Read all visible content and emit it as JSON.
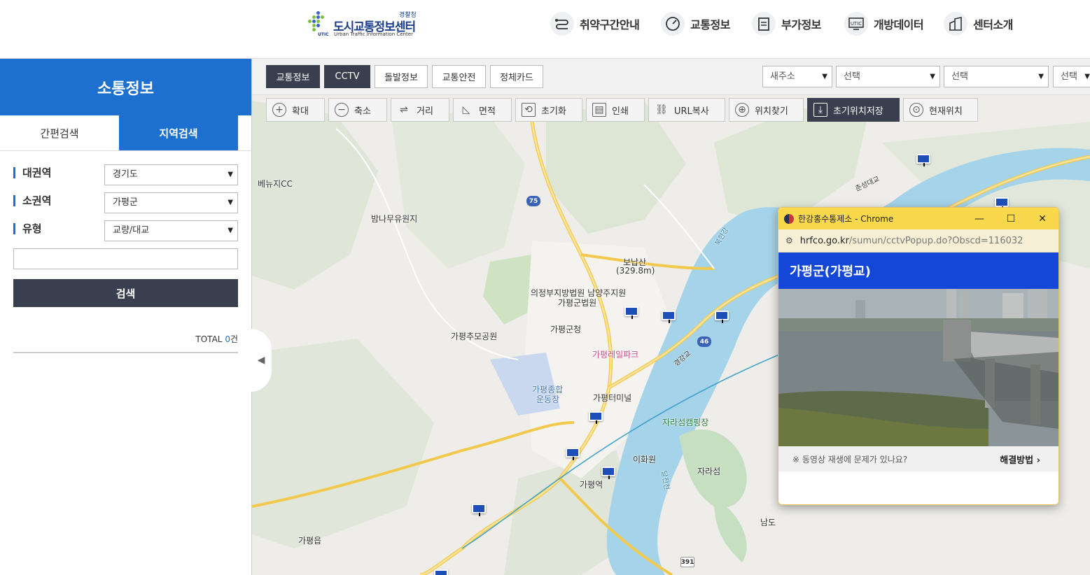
{
  "header": {
    "logo_title": "도시교통정보센터",
    "logo_police": "경찰청",
    "logo_en": "Urban Traffic Information Center",
    "logo_utic": "UTIC",
    "nav": [
      {
        "label": "취약구간안내",
        "icon": "route-icon"
      },
      {
        "label": "교통정보",
        "icon": "gauge-icon"
      },
      {
        "label": "부가정보",
        "icon": "clipboard-icon"
      },
      {
        "label": "개방데이터",
        "icon": "utic-monitor-icon"
      },
      {
        "label": "센터소개",
        "icon": "building-icon"
      }
    ]
  },
  "sidebar": {
    "title": "소통정보",
    "tabs": [
      "간편검색",
      "지역검색"
    ],
    "fields": [
      {
        "label": "대권역",
        "value": "경기도"
      },
      {
        "label": "소권역",
        "value": "가평군"
      },
      {
        "label": "유형",
        "value": "교량/대교"
      }
    ],
    "search_value": "",
    "search_button": "검색",
    "total_prefix": "TOTAL",
    "total_count": "0",
    "total_suffix": "건"
  },
  "map_topbar": {
    "tabs": [
      {
        "label": "교통정보",
        "active": true
      },
      {
        "label": "CCTV",
        "active": true
      },
      {
        "label": "돌발정보",
        "active": false
      },
      {
        "label": "교통안전",
        "active": false
      },
      {
        "label": "정체카드",
        "active": false
      }
    ],
    "selects": [
      "새주소",
      "선택",
      "선택",
      "선택"
    ]
  },
  "tools": [
    {
      "label": "확대",
      "icon": "zoom-in-icon"
    },
    {
      "label": "축소",
      "icon": "zoom-out-icon"
    },
    {
      "label": "거리",
      "icon": "distance-icon"
    },
    {
      "label": "면적",
      "icon": "area-icon"
    },
    {
      "label": "초기화",
      "icon": "reset-icon"
    },
    {
      "label": "인쇄",
      "icon": "print-icon"
    },
    {
      "label": "URL복사",
      "icon": "link-icon"
    },
    {
      "label": "위치찾기",
      "icon": "locate-icon"
    },
    {
      "label": "초기위치저장",
      "icon": "download-icon"
    },
    {
      "label": "현재위치",
      "icon": "current-location-icon"
    }
  ],
  "map_labels": [
    "베뉴지CC",
    "밤나무유원지",
    "보납산",
    "(329.8m)",
    "의정부지방법원 남양주지원",
    "가평군법원",
    "가평군청",
    "가평추모공원",
    "가평레일파크",
    "가평종합",
    "운동장",
    "가평터미널",
    "자라섬캠핑장",
    "이화원",
    "자라섬",
    "가평역",
    "가평읍",
    "남도",
    "경강교",
    "춘성대교",
    "북한강",
    "달전천"
  ],
  "route_shields": [
    "75",
    "46",
    "391"
  ],
  "popup": {
    "window_title": "한강홍수통제소 - Chrome",
    "url_host": "hrfco.go.kr",
    "url_path": "/sumun/cctvPopup.do?Obscd=116032",
    "heading": "가평군(가평교)",
    "notice": "※ 동영상 재생에 문제가 있나요?",
    "fix_link": "해결방법"
  },
  "colors": {
    "brand_blue": "#1d6fd0",
    "dark_button": "#3a3f4f",
    "popup_header": "#1447d8",
    "chrome_bar": "#f9d94b",
    "river": "#a5d3ea"
  }
}
